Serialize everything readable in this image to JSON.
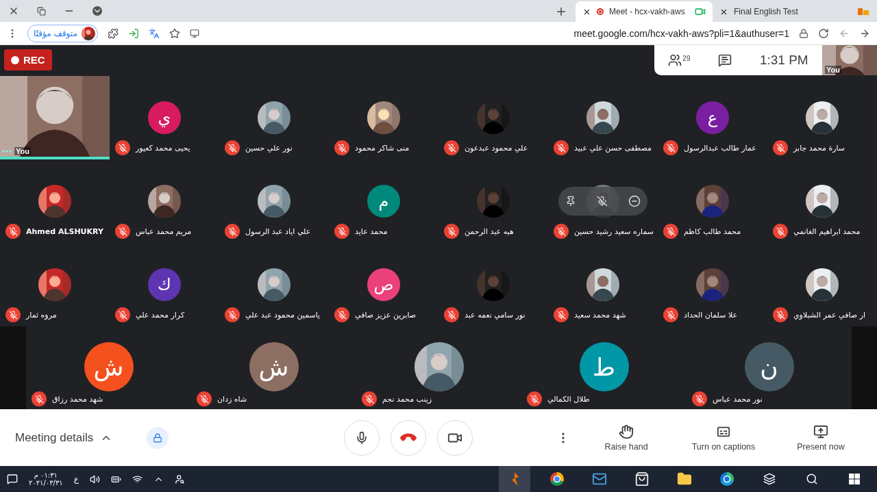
{
  "browser": {
    "tabs": [
      {
        "title": "Final English Test",
        "selected": false,
        "recording": false
      },
      {
        "title": "Meet - hcx-vakh-aws",
        "selected": true,
        "recording": true
      }
    ],
    "profile_chip": "متوقف مؤقتًا",
    "address": "meet.google.com/hcx-vakh-aws?pli=1&authuser=1"
  },
  "meeting": {
    "rec_label": "REC",
    "people_count": "29",
    "time": "1:31 PM",
    "self_label": "You"
  },
  "grid_rows": [
    [
      {
        "name": "سارة محمد جابر",
        "muted": true,
        "hovered": false
      },
      {
        "kind": "letter",
        "letter": "ع",
        "color": "#7b1fa2",
        "name": "عمار طالب عبدالرسول",
        "muted": true,
        "hovered": false
      },
      {
        "name": "مصطفى حسن علي عبيد",
        "muted": true,
        "hovered": false
      },
      {
        "name": "علي محمود عبدعون",
        "muted": true,
        "hovered": false
      },
      {
        "name": "منى شاكر محمود",
        "muted": true,
        "hovered": false
      },
      {
        "name": "نور علي حسين",
        "muted": true,
        "hovered": false
      },
      {
        "kind": "letter",
        "letter": "ي",
        "color": "#d81b60",
        "name": "يحيى محمد كعيور",
        "muted": true,
        "hovered": false
      },
      {
        "kind": "self",
        "name": "You"
      }
    ],
    [
      {
        "name": "محمد ابراهيم الغانمي",
        "muted": true,
        "hovered": false
      },
      {
        "name": "محمد طالب كاظم",
        "muted": true,
        "hovered": false
      },
      {
        "name": "سماره سعيد رشيد حسين",
        "muted": true,
        "hovered": true
      },
      {
        "name": "هبه عبد الرحمن",
        "muted": true,
        "hovered": false
      },
      {
        "kind": "letter",
        "letter": "م",
        "color": "#00897b",
        "name": "محمد عايد",
        "muted": true,
        "hovered": false
      },
      {
        "name": "علي اياد عبد الرسول",
        "muted": true,
        "hovered": false
      },
      {
        "name": "مريم محمد عباس",
        "muted": true,
        "hovered": false
      },
      {
        "name": "Ahmed ALSHUKRY",
        "muted": true,
        "hovered": false
      }
    ],
    [
      {
        "name": "ار صافي عمر الشبلاوي",
        "muted": true,
        "hovered": false
      },
      {
        "name": "علا سلمان الحداد",
        "muted": true,
        "hovered": false
      },
      {
        "name": "شهد محمد سعيد",
        "muted": true,
        "hovered": false
      },
      {
        "name": "نور سامي نعمه عبد",
        "muted": true,
        "hovered": false
      },
      {
        "kind": "letter",
        "letter": "ص",
        "color": "#ec407a",
        "name": "صابرين عزيز صافي",
        "muted": true,
        "hovered": false
      },
      {
        "name": "ياسمين محمود عبد علي",
        "muted": true,
        "hovered": false
      },
      {
        "kind": "letter",
        "letter": "ك",
        "color": "#5e35b1",
        "name": "كرار محمد علي",
        "muted": true,
        "hovered": false
      },
      {
        "name": "مروه ثمار",
        "muted": true,
        "hovered": false
      }
    ]
  ],
  "bottom_lane": [
    {
      "kind": "letter",
      "letter": "ن",
      "color": "#455a64",
      "name": "نور محمد عباس",
      "muted": true
    },
    {
      "kind": "letter",
      "letter": "ط",
      "color": "#0097a7",
      "name": "طلال الكمالي",
      "muted": true
    },
    {
      "name": "زينب محمد نجم",
      "muted": true
    },
    {
      "kind": "letter",
      "letter": "ش",
      "color": "#8d6e63",
      "name": "شاه زدان",
      "muted": true
    },
    {
      "kind": "letter",
      "letter": "ش",
      "color": "#f4511e",
      "name": "شهد محمد رزاق",
      "muted": true
    }
  ],
  "bottom_bar": {
    "details": "Meeting details",
    "actions": [
      {
        "kind": "present",
        "label": "Present now"
      },
      {
        "kind": "captions",
        "label": "Turn on captions"
      },
      {
        "kind": "hand",
        "label": "Raise hand"
      }
    ]
  },
  "taskbar": {
    "time": "٠١:٣١ م",
    "date": "٢٠٢١/٠٣/٣١",
    "language": "ع"
  }
}
